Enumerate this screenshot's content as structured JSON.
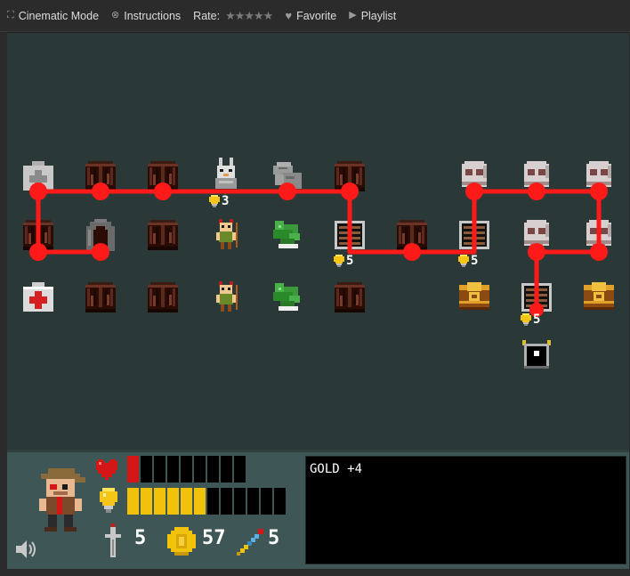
{
  "toolbar": {
    "cinematic_label": "Cinematic Mode",
    "instructions_label": "Instructions",
    "rate_label": "Rate:",
    "rating_stars": "★★★★★",
    "favorite_label": "Favorite",
    "playlist_label": "Playlist",
    "icons": {
      "cinematic": "fullscreen-icon",
      "instructions": "help-icon",
      "favorite": "heart-icon",
      "playlist": "play-icon"
    }
  },
  "board": {
    "costs": [
      "3",
      "5",
      "5",
      "5"
    ],
    "colors": {
      "path": "#ff1a1a",
      "background": "#2a3838"
    }
  },
  "hud": {
    "health": {
      "filled": 1,
      "total": 9,
      "color": "#d41616"
    },
    "light": {
      "filled": 6,
      "total": 12,
      "color": "#f0c20c"
    },
    "attack": "5",
    "gold": "57",
    "magic": "5",
    "log": "GOLD +4",
    "icons": [
      "heart-icon",
      "lightbulb-icon",
      "sword-icon",
      "coin-icon",
      "wand-icon",
      "speaker-icon"
    ]
  }
}
